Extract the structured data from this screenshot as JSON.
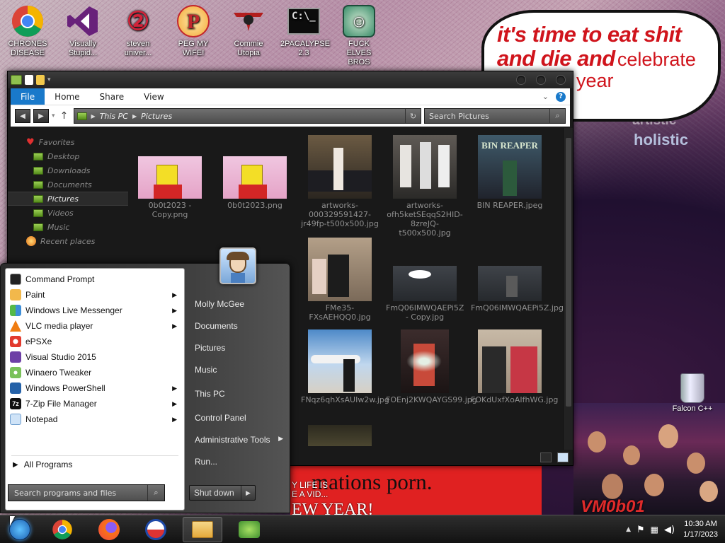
{
  "desktop_icons": [
    {
      "label": "CHRONES DISEASE",
      "icon": "chrome-icon"
    },
    {
      "label": "Visually Stupid...",
      "icon": "visual-studio-icon"
    },
    {
      "label": "steven univer...",
      "icon": "steven-universe-icon"
    },
    {
      "label": "PEG MY WIFE!",
      "icon": "p-logo-icon"
    },
    {
      "label": "Commie Utopia",
      "icon": "commie-icon"
    },
    {
      "label": "2PACALYPSE 2.3",
      "icon": "cmd-icon"
    },
    {
      "label": "FUCK ELVES BROS",
      "icon": "elf-icon"
    }
  ],
  "wallpaper": {
    "speech_line1": "it's time to eat shit",
    "speech_line2_a": "and die and",
    "speech_line2_b": "celebrate",
    "speech_line3": "year",
    "artistic": "artistic",
    "holistic": "holistic",
    "banner_big": "mations porn.",
    "banner_small": "Y LIFE IS\nE A VID...",
    "banner_year": "EW YEAR!",
    "vm_text": "VM0b01"
  },
  "recycle_bin": {
    "label": "Falcon C++"
  },
  "explorer": {
    "ribbon_tabs": [
      "File",
      "Home",
      "Share",
      "View"
    ],
    "address": [
      "This PC",
      "Pictures"
    ],
    "search_placeholder": "Search Pictures",
    "nav": {
      "favorites": "Favorites",
      "items": [
        "Desktop",
        "Downloads",
        "Documents",
        "Pictures",
        "Videos",
        "Music"
      ],
      "recent": "Recent places"
    },
    "files": [
      {
        "name": "0b0t2023 - Copy.png"
      },
      {
        "name": "0b0t2023.png"
      },
      {
        "name": "artworks-000329591427-jr49fp-t500x500.jpg"
      },
      {
        "name": "artworks-ofh5ketSEqqS2HID-8zreJQ-t500x500.jpg"
      },
      {
        "name": "BIN REAPER.jpeg"
      },
      {
        "name": "FMe35-FXsAEHQQ0.jpg"
      },
      {
        "name": "FmQ06IMWQAEPi5Z - Copy.jpg"
      },
      {
        "name": "FmQ06IMWQAEPi5Z.jpg"
      },
      {
        "name": "FNqz6qhXsAUIw2w.jpg"
      },
      {
        "name": "FOEnj2KWQAYGS99.jpg"
      },
      {
        "name": "FOKdUxfXoAIfhWG.jpg"
      },
      {
        "name": ""
      }
    ],
    "thumb_text": {
      "bin_reaper": "BIN REAPER"
    }
  },
  "start_menu": {
    "programs": [
      {
        "label": "Command Prompt",
        "icon": "cmd-icon",
        "arrow": false,
        "color": "#222"
      },
      {
        "label": "Paint",
        "icon": "paint-icon",
        "arrow": true,
        "color": "#f2b84b"
      },
      {
        "label": "Windows Live Messenger",
        "icon": "messenger-icon",
        "arrow": true,
        "color": "#55b948"
      },
      {
        "label": "VLC media player",
        "icon": "vlc-icon",
        "arrow": true,
        "color": "#f07d12"
      },
      {
        "label": "ePSXe",
        "icon": "epsxe-icon",
        "arrow": false,
        "color": "#e23a2e"
      },
      {
        "label": "Visual Studio 2015",
        "icon": "visual-studio-icon",
        "arrow": false,
        "color": "#6d3fa6"
      },
      {
        "label": "Winaero Tweaker",
        "icon": "winaero-icon",
        "arrow": false,
        "color": "#7ac15a"
      },
      {
        "label": "Windows PowerShell",
        "icon": "powershell-icon",
        "arrow": true,
        "color": "#2461a8"
      },
      {
        "label": "7-Zip File Manager",
        "icon": "7zip-icon",
        "arrow": true,
        "color": "#111"
      },
      {
        "label": "Notepad",
        "icon": "notepad-icon",
        "arrow": true,
        "color": "#7bb2e3"
      }
    ],
    "all_programs": "All Programs",
    "search_placeholder": "Search programs and files",
    "right_links": [
      "Molly McGee",
      "Documents",
      "Pictures",
      "Music",
      "This PC",
      "Control Panel",
      "Administrative Tools",
      "Run..."
    ],
    "shutdown": "Shut down"
  },
  "taskbar": {
    "pins": [
      "start-orb-icon",
      "chrome-icon",
      "firefox-icon",
      "obama-logo-icon",
      "file-explorer-icon",
      "network-app-icon"
    ],
    "time": "10:30 AM",
    "date": "1/17/2023"
  }
}
